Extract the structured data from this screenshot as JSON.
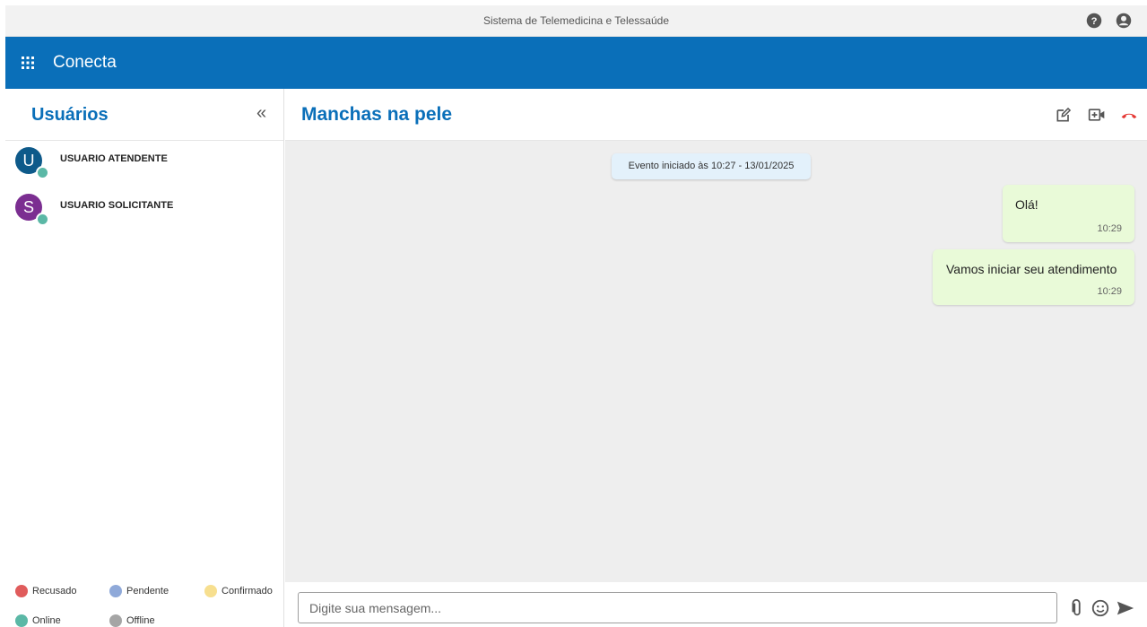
{
  "topbar": {
    "title": "Sistema de Telemedicina e Telessaúde",
    "icons": [
      "help-icon",
      "account-icon"
    ]
  },
  "appbar": {
    "app_name": "Conecta",
    "icon": "apps-grid-icon"
  },
  "sidebar": {
    "title": "Usuários",
    "collapse_glyph": "«",
    "users": [
      {
        "initial": "U",
        "name": "USUARIO ATENDENTE",
        "avatar_color": "#0e5a8a",
        "status": "Online"
      },
      {
        "initial": "S",
        "name": "USUARIO SOLICITANTE",
        "avatar_color": "#7b2e91",
        "status": "Online"
      }
    ],
    "legend": [
      {
        "label": "Recusado",
        "color": "#e05c5c"
      },
      {
        "label": "Pendente",
        "color": "#8fa9d9"
      },
      {
        "label": "Confirmado",
        "color": "#f7df8f"
      },
      {
        "label": "Online",
        "color": "#5bb8a6"
      },
      {
        "label": "Offline",
        "color": "#a5a5a5"
      }
    ]
  },
  "chat": {
    "title": "Manchas na pele",
    "header_icons": [
      "edit-icon",
      "add-video-icon",
      "end-call-icon"
    ],
    "event_text": "Evento iniciado às 10:27 - 13/01/2025",
    "messages": [
      {
        "text": "Olá!",
        "time": "10:29"
      },
      {
        "text": "Vamos iniciar seu atendimento",
        "time": "10:29"
      }
    ],
    "composer": {
      "placeholder": "Digite sua mensagem...",
      "value": ""
    }
  },
  "colors": {
    "primary": "#0a6fb9",
    "bubble": "#e9fad8",
    "event": "#e3f1fb",
    "end_call": "#e53935"
  }
}
